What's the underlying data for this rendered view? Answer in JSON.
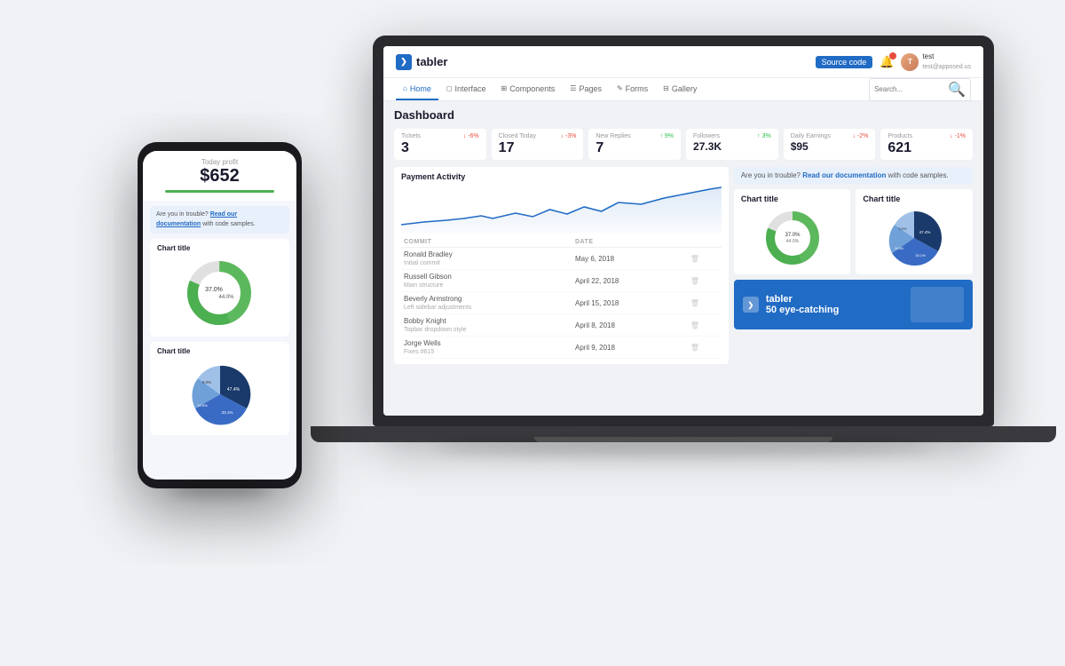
{
  "brand": {
    "name": "tabler",
    "icon": "❯"
  },
  "navbar": {
    "source_code_label": "Source code",
    "user": {
      "name": "test",
      "email": "test@apposed.us",
      "initials": "T"
    }
  },
  "nav_tabs": [
    {
      "label": "Home",
      "icon": "⌂",
      "active": true
    },
    {
      "label": "Interface",
      "icon": "◻"
    },
    {
      "label": "Components",
      "icon": "⊞"
    },
    {
      "label": "Pages",
      "icon": "☰"
    },
    {
      "label": "Forms",
      "icon": "✎"
    },
    {
      "label": "Gallery",
      "icon": "⊟"
    }
  ],
  "search": {
    "placeholder": "Search..."
  },
  "dashboard": {
    "title": "Dashboard",
    "stats": [
      {
        "value": "3",
        "label": "Tickets",
        "change": "-6%",
        "trend": "down"
      },
      {
        "value": "17",
        "label": "Closed Today",
        "change": "-3%",
        "trend": "down"
      },
      {
        "value": "7",
        "label": "New Replies",
        "change": "9%",
        "trend": "up"
      },
      {
        "value": "27.3K",
        "label": "Followers",
        "change": "3%",
        "trend": "up"
      },
      {
        "value": "$95",
        "label": "Daily Earnings",
        "change": "-2%",
        "trend": "down"
      },
      {
        "value": "621",
        "label": "Products",
        "change": "-1%",
        "trend": "down"
      }
    ],
    "alert": {
      "text_before": "Are you in trouble?",
      "link": "Read our documentation",
      "text_after": "with code samples."
    },
    "activity": {
      "title": "Payment Activity",
      "commits": [
        {
          "author": "Ronald Bradley",
          "message": "Initial commit",
          "date": "May 6, 2018"
        },
        {
          "author": "Russell Gibson",
          "message": "Main structure",
          "date": "April 22, 2018"
        },
        {
          "author": "Beverly Armstrong",
          "message": "Left sidebar adjustments",
          "date": "April 15, 2018"
        },
        {
          "author": "Bobby Knight",
          "message": "Topbar dropdown style",
          "date": "April 8, 2018"
        },
        {
          "author": "Jorge Wells",
          "message": "Fixes #615",
          "date": "April 9, 2018"
        }
      ]
    },
    "chart1": {
      "title": "Chart title",
      "segments": [
        {
          "label": "37.0%",
          "value": 37,
          "color": "#4caf50"
        },
        {
          "label": "44.0%",
          "value": 44,
          "color": "#5cb85c"
        },
        {
          "label": "19.0%",
          "value": 19,
          "color": "#e0e0e0"
        }
      ]
    },
    "chart2": {
      "title": "Chart title",
      "segments": [
        {
          "label": "47.4%",
          "value": 47.4,
          "color": "#1a3a6b"
        },
        {
          "label": "33.1%",
          "value": 33.1,
          "color": "#3a6bc4"
        },
        {
          "label": "10.5%",
          "value": 10.5,
          "color": "#6fa0d8"
        },
        {
          "label": "9.0%",
          "value": 9,
          "color": "#a0c0e8"
        }
      ]
    },
    "promo": {
      "title": "50 eye-catching",
      "brand": "tabler"
    }
  },
  "phone": {
    "today_label": "Today profit",
    "amount": "$652",
    "alert": {
      "text_before": "Are you in trouble?",
      "link": "Read our documentation",
      "text_after": "with code samples."
    },
    "chart1": {
      "title": "Chart title"
    },
    "chart2": {
      "title": "Chart title"
    }
  }
}
